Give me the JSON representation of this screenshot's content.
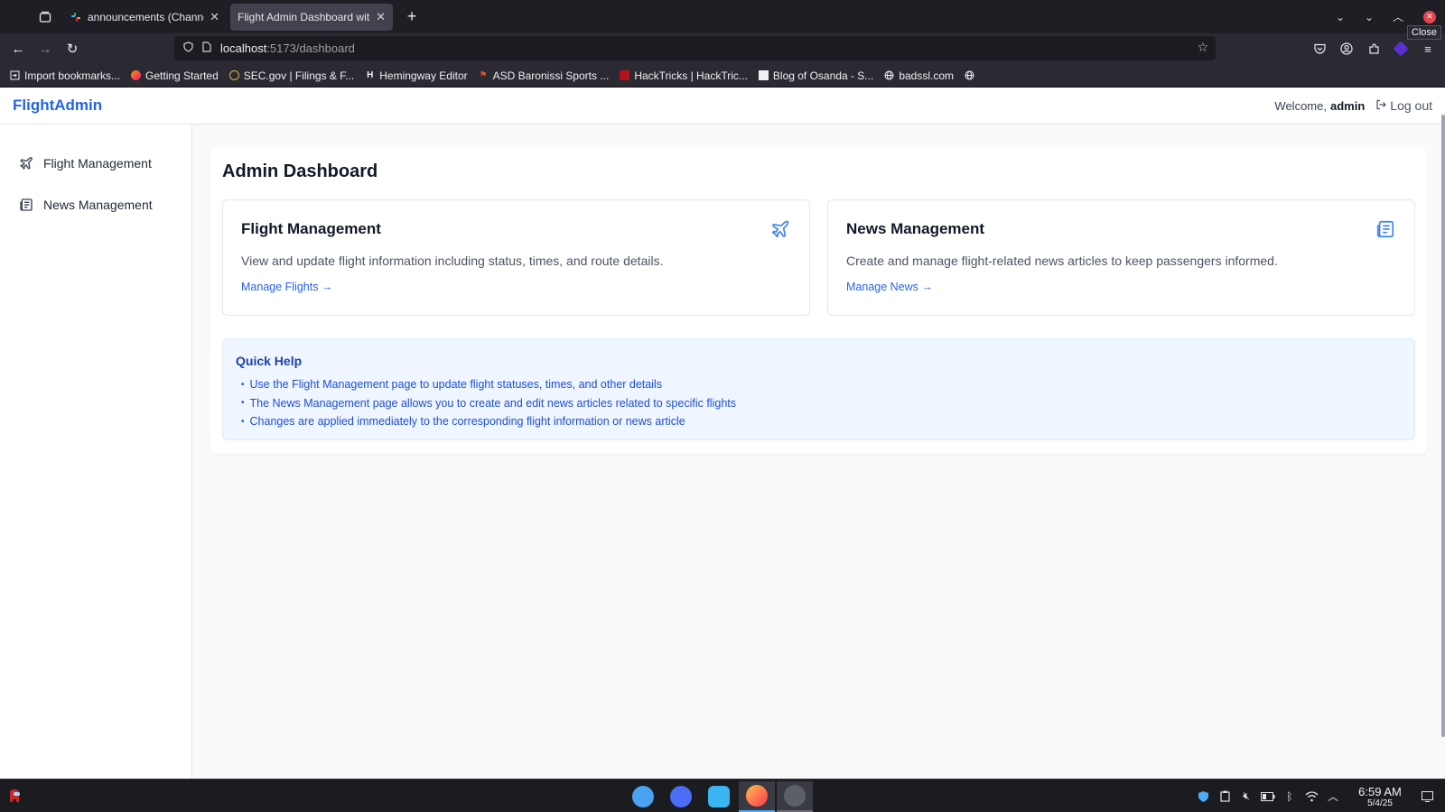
{
  "browser": {
    "tabs": [
      {
        "title": "announcements (Channel)",
        "active": false,
        "favicon": "slack-icon"
      },
      {
        "title": "Flight Admin Dashboard with ·",
        "active": true,
        "favicon": null
      }
    ],
    "tooltip": "Close",
    "url_host": "localhost",
    "url_path": ":5173/dashboard",
    "bookmarks": [
      {
        "label": "Import bookmarks..."
      },
      {
        "label": "Getting Started"
      },
      {
        "label": "SEC.gov | Filings & F..."
      },
      {
        "label": "Hemingway Editor"
      },
      {
        "label": "ASD Baronissi Sports ..."
      },
      {
        "label": "HackTricks | HackTric..."
      },
      {
        "label": "Blog of Osanda - S..."
      },
      {
        "label": "badssl.com"
      }
    ]
  },
  "app": {
    "brand": "FlightAdmin",
    "welcome": "Welcome,",
    "username": "admin",
    "logout": "Log out",
    "sidebar": [
      {
        "label": "Flight Management",
        "icon": "plane-icon"
      },
      {
        "label": "News Management",
        "icon": "newspaper-icon"
      }
    ],
    "page_title": "Admin Dashboard",
    "cards": [
      {
        "title": "Flight Management",
        "description": "View and update flight information including status, times, and route details.",
        "link": "Manage Flights →",
        "icon": "plane-icon"
      },
      {
        "title": "News Management",
        "description": "Create and manage flight-related news articles to keep passengers informed.",
        "link": "Manage News →",
        "icon": "newspaper-icon"
      }
    ],
    "help": {
      "title": "Quick Help",
      "items": [
        "Use the Flight Management page to update flight statuses, times, and other details",
        "The News Management page allows you to create and edit news articles related to specific flights",
        "Changes are applied immediately to the corresponding flight information or news article"
      ]
    }
  },
  "taskbar": {
    "time": "6:59 AM",
    "date": "5/4/25"
  },
  "colors": {
    "accent": "#2563eb",
    "help_bg": "#eff6ff",
    "help_text": "#1d4ed8"
  }
}
